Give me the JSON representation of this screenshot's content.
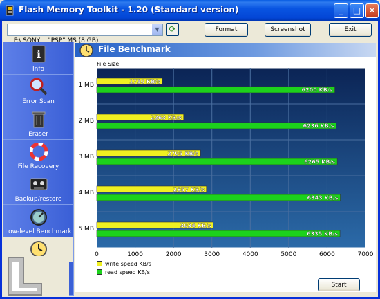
{
  "window": {
    "title": "Flash Memory Toolkit - 1.20 (Standard version)",
    "minimize": "_",
    "maximize": "□",
    "close": "✕"
  },
  "toolbar": {
    "drive": "F:\\ SONY    \"PSP\" MS (8 GB)",
    "format_label": "Format",
    "screenshot_label": "Screenshot",
    "exit_label": "Exit"
  },
  "sidebar": {
    "items": [
      {
        "label": "Info",
        "icon": "info-icon"
      },
      {
        "label": "Error Scan",
        "icon": "magnifier-icon"
      },
      {
        "label": "Eraser",
        "icon": "trash-icon"
      },
      {
        "label": "File Recovery",
        "icon": "lifebuoy-icon"
      },
      {
        "label": "Backup/restore",
        "icon": "tape-icon"
      },
      {
        "label": "Low-level Benchmark",
        "icon": "stopwatch-icon"
      },
      {
        "label": "File Benchmark",
        "icon": "clock-icon"
      }
    ],
    "active_index": 6
  },
  "panel": {
    "title": "File Benchmark",
    "start_label": "Start"
  },
  "colors": {
    "write": "#f0f021",
    "read": "#1cd21c",
    "plot_top": "#0b2455",
    "plot_bottom": "#2b6aa8"
  },
  "chart_data": {
    "type": "bar",
    "orientation": "horizontal",
    "ylabel": "File Size",
    "categories": [
      "1 MB",
      "2 MB",
      "3 MB",
      "4 MB",
      "5 MB"
    ],
    "series": [
      {
        "name": "write speed KB/s",
        "values": [
          1710,
          2263,
          2705,
          2857,
          3034
        ],
        "labels": [
          "1710 KB/s",
          "2263 KB/s",
          "2705 KB/s",
          "2857 KB/s",
          "3034 KB/s"
        ]
      },
      {
        "name": "read speed KB/s",
        "values": [
          6200,
          6236,
          6265,
          6343,
          6335
        ],
        "labels": [
          "6200 KB/s",
          "6236 KB/s",
          "6265 KB/s",
          "6343 KB/s",
          "6335 KB/s"
        ]
      }
    ],
    "xlim": [
      0,
      7000
    ],
    "xticks": [
      "0",
      "1000",
      "2000",
      "3000",
      "4000",
      "5000",
      "6000",
      "7000"
    ],
    "legend": "bottom-left",
    "grid": true
  }
}
